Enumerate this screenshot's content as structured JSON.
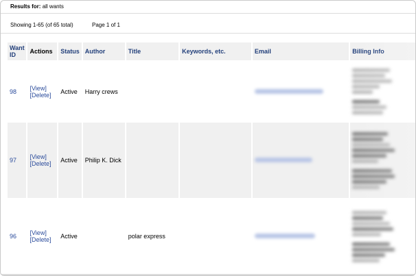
{
  "header": {
    "results_label": "Results for:",
    "results_value": "all wants",
    "showing": "Showing 1-65 (of 65 total)",
    "page": "Page 1 of 1"
  },
  "table": {
    "columns": [
      "Want ID",
      "Actions",
      "Status",
      "Author",
      "Title",
      "Keywords, etc.",
      "Email",
      "Billing Info"
    ],
    "rows": [
      {
        "id": "98",
        "view": "[View]",
        "delete": "[Delete]",
        "status": "Active",
        "author": "Harry crews",
        "title": "",
        "keywords": ""
      },
      {
        "id": "97",
        "view": "[View]",
        "delete": "[Delete]",
        "status": "Active",
        "author": "Philip K. Dick",
        "title": "",
        "keywords": ""
      },
      {
        "id": "96",
        "view": "[View]",
        "delete": "[Delete]",
        "status": "Active",
        "author": "",
        "title": "polar express",
        "keywords": ""
      }
    ]
  },
  "colors": {
    "header_bg": "#f0f0f0",
    "link": "#2a4b9b",
    "header_text": "#223f7a"
  }
}
